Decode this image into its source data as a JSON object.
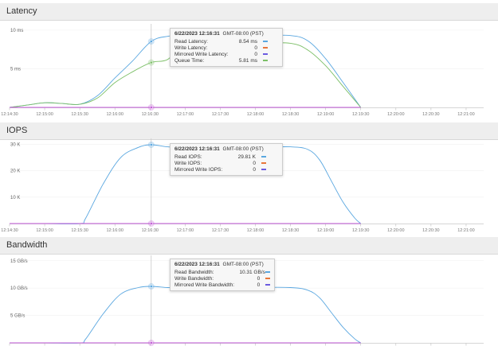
{
  "x_axis_ticks": [
    "12:14:30",
    "12:15:00",
    "12:15:30",
    "12:16:00",
    "12:16:30",
    "12:17:00",
    "12:17:30",
    "12:18:00",
    "12:18:30",
    "12:19:00",
    "12:19:30",
    "12:20:00",
    "12:20:30",
    "12:21:00"
  ],
  "colors": {
    "read": "#5aa7e0",
    "write": "#e8763a",
    "mirrored": "#c35ad8",
    "queue": "#7cbf67"
  },
  "panels": [
    {
      "title": "Latency",
      "tooltip": {
        "timestamp": "6/22/2023 12:16:31",
        "timezone": "GMT-08:00 (PST)",
        "rows": [
          {
            "label": "Read Latency:",
            "value": "8.54  ms",
            "color": "#5aa7e0"
          },
          {
            "label": "Write Latency:",
            "value": "0",
            "color": "#e8763a"
          },
          {
            "label": "Mirrored Write Latency:",
            "value": "0",
            "color": "#6b5be0"
          },
          {
            "label": "Queue Time:",
            "value": "5.81  ms",
            "color": "#7cbf67"
          }
        ]
      }
    },
    {
      "title": "IOPS",
      "tooltip": {
        "timestamp": "6/22/2023 12:16:31",
        "timezone": "GMT-08:00 (PST)",
        "rows": [
          {
            "label": "Read IOPS:",
            "value": "29.81  K",
            "color": "#5aa7e0"
          },
          {
            "label": "Write IOPS:",
            "value": "0",
            "color": "#e8763a"
          },
          {
            "label": "Mirrored Write IOPS:",
            "value": "0",
            "color": "#6b5be0"
          }
        ]
      }
    },
    {
      "title": "Bandwidth",
      "tooltip": {
        "timestamp": "6/22/2023 12:16:31",
        "timezone": "GMT-08:00 (PST)",
        "rows": [
          {
            "label": "Read Bandwidth:",
            "value": "10.31  GB/s",
            "color": "#5aa7e0"
          },
          {
            "label": "Write Bandwidth:",
            "value": "0",
            "color": "#e8763a"
          },
          {
            "label": "Mirrored Write Bandwidth:",
            "value": "0",
            "color": "#6b5be0"
          }
        ]
      }
    }
  ],
  "chart_data": [
    {
      "type": "line",
      "title": "Latency",
      "x": [
        "12:14:30",
        "12:14:45",
        "12:15:00",
        "12:15:15",
        "12:15:30",
        "12:15:45",
        "12:16:00",
        "12:16:15",
        "12:16:31",
        "12:16:45",
        "12:17:00",
        "12:17:30",
        "12:18:00",
        "12:18:30",
        "12:18:45",
        "12:19:00",
        "12:19:15",
        "12:19:30"
      ],
      "y_ticks": [
        {
          "value": 10,
          "label": "10 ms"
        },
        {
          "value": 5,
          "label": "5 ms"
        }
      ],
      "ylim": [
        0,
        10.4
      ],
      "xlim": [
        "12:14:30",
        "12:21:15"
      ],
      "series": [
        {
          "name": "Read Latency",
          "color": "#5aa7e0",
          "values": [
            0,
            0.3,
            0.6,
            0.5,
            0.4,
            1.5,
            3.8,
            6.0,
            8.54,
            9.2,
            9.3,
            9.3,
            9.3,
            9.3,
            8.6,
            6.3,
            3.2,
            0
          ]
        },
        {
          "name": "Queue Time",
          "color": "#7cbf67",
          "values": [
            0,
            0.3,
            0.6,
            0.5,
            0.4,
            1.2,
            3.2,
            4.6,
            5.81,
            6.2,
            8.2,
            8.2,
            8.3,
            8.3,
            7.4,
            5.4,
            2.7,
            0
          ]
        },
        {
          "name": "Mirrored Write Latency",
          "color": "#c35ad8",
          "values": [
            0,
            0,
            0,
            0,
            0,
            0,
            0,
            0,
            0,
            0,
            0,
            0,
            0,
            0,
            0,
            0,
            0,
            0
          ]
        }
      ]
    },
    {
      "type": "line",
      "title": "IOPS",
      "x": [
        "12:14:30",
        "12:15:00",
        "12:15:30",
        "12:15:35",
        "12:15:50",
        "12:16:05",
        "12:16:20",
        "12:16:31",
        "12:16:45",
        "12:17:00",
        "12:17:30",
        "12:18:00",
        "12:18:30",
        "12:18:45",
        "12:18:55",
        "12:19:05",
        "12:19:15",
        "12:19:25",
        "12:19:30"
      ],
      "y_ticks": [
        {
          "value": 30,
          "label": "30 K"
        },
        {
          "value": 20,
          "label": "20 K"
        },
        {
          "value": 10,
          "label": "10 K"
        }
      ],
      "ylim": [
        0,
        31
      ],
      "xlim": [
        "12:14:30",
        "12:21:15"
      ],
      "series": [
        {
          "name": "Read IOPS",
          "color": "#5aa7e0",
          "values": [
            0,
            0,
            0,
            2,
            15,
            25,
            28.8,
            29.81,
            29,
            28.7,
            28.5,
            28.8,
            29,
            28,
            24,
            16,
            8,
            2,
            0
          ]
        },
        {
          "name": "Mirrored Write IOPS",
          "color": "#c35ad8",
          "values": [
            0,
            0,
            0,
            0,
            0,
            0,
            0,
            0,
            0,
            0,
            0,
            0,
            0,
            0,
            0,
            0,
            0,
            0,
            0
          ]
        }
      ]
    },
    {
      "type": "line",
      "title": "Bandwidth",
      "x": [
        "12:14:30",
        "12:15:00",
        "12:15:30",
        "12:15:35",
        "12:15:50",
        "12:16:05",
        "12:16:20",
        "12:16:31",
        "12:16:45",
        "12:17:00",
        "12:17:30",
        "12:18:00",
        "12:18:30",
        "12:18:45",
        "12:18:55",
        "12:19:05",
        "12:19:15",
        "12:19:25",
        "12:19:30"
      ],
      "y_ticks": [
        {
          "value": 15,
          "label": "15 GB/s"
        },
        {
          "value": 10,
          "label": "10 GB/s"
        },
        {
          "value": 5,
          "label": "5 GB/s"
        }
      ],
      "ylim": [
        0,
        15.4
      ],
      "xlim": [
        "12:14:30",
        "12:21:15"
      ],
      "series": [
        {
          "name": "Read Bandwidth",
          "color": "#5aa7e0",
          "values": [
            0,
            0,
            0,
            0.7,
            5.3,
            8.9,
            10.1,
            10.31,
            10.1,
            10.0,
            9.95,
            10.1,
            10.1,
            9.6,
            8.2,
            5.5,
            2.8,
            0.7,
            0
          ]
        },
        {
          "name": "Mirrored Write Bandwidth",
          "color": "#c35ad8",
          "values": [
            0,
            0,
            0,
            0,
            0,
            0,
            0,
            0,
            0,
            0,
            0,
            0,
            0,
            0,
            0,
            0,
            0,
            0,
            0
          ]
        }
      ]
    }
  ]
}
